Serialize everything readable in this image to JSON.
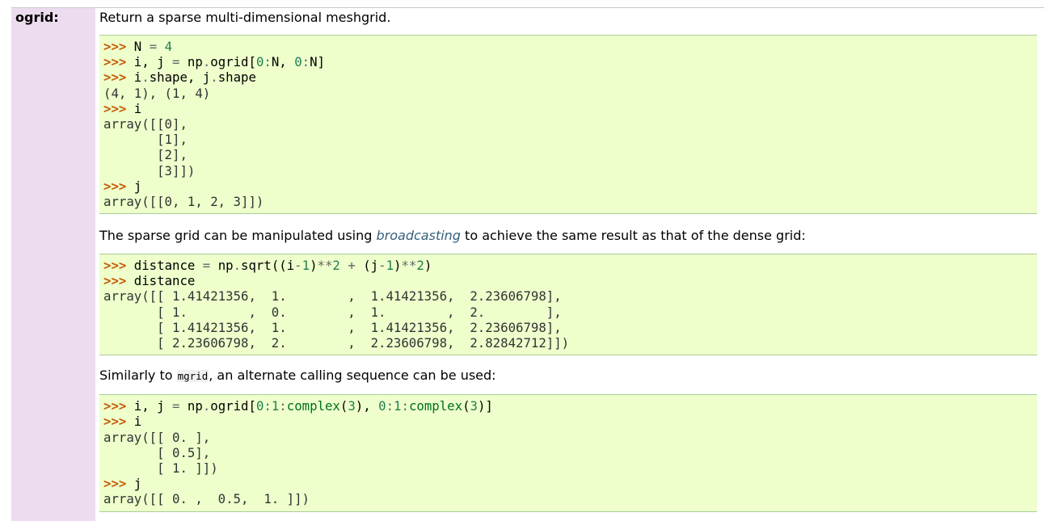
{
  "field": {
    "name": "ogrid:",
    "summary": "Return a sparse multi-dimensional meshgrid."
  },
  "example1": {
    "lines": [
      ">>> N = 4",
      ">>> i, j = np.ogrid[0:N, 0:N]",
      ">>> i.shape, j.shape",
      "(4, 1), (1, 4)",
      ">>> i",
      "array([[0],",
      "       [1],",
      "       [2],",
      "       [3]])",
      ">>> j",
      "array([[0, 1, 2, 3]])"
    ]
  },
  "paragraph2": {
    "before": "The sparse grid can be manipulated using ",
    "link": "broadcasting",
    "after": " to achieve the same result as that of the dense grid:"
  },
  "example2": {
    "lines": [
      ">>> distance = np.sqrt((i-1)**2 + (j-1)**2)",
      ">>> distance",
      "array([[ 1.41421356,  1.        ,  1.41421356,  2.23606798],",
      "       [ 1.        ,  0.        ,  1.        ,  2.        ],",
      "       [ 1.41421356,  1.        ,  1.41421356,  2.23606798],",
      "       [ 2.23606798,  2.        ,  2.23606798,  2.82842712]])"
    ]
  },
  "paragraph3": {
    "before": "Similarly to ",
    "code": "mgrid",
    "after": ", an alternate calling sequence can be used:"
  },
  "example3": {
    "lines": [
      ">>> i, j = np.ogrid[0:1:complex(3), 0:1:complex(3)]",
      ">>> i",
      "array([[ 0. ],",
      "       [ 0.5],",
      "       [ 1. ]])",
      ">>> j",
      "array([[ 0. ,  0.5,  1. ]])"
    ]
  }
}
